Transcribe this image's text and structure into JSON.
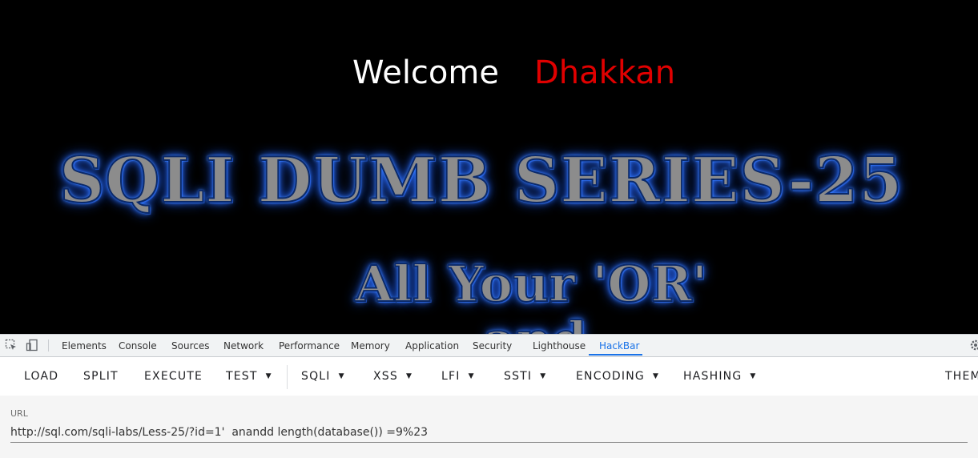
{
  "page": {
    "welcome_text": "Welcome",
    "user_name": "Dhakkan",
    "banner_title": "SQLI DUMB SERIES-25",
    "banner_subtitle": "All Your 'OR'",
    "banner_partial": "and"
  },
  "devtools": {
    "tabs": [
      "Elements",
      "Console",
      "Sources",
      "Network",
      "Performance",
      "Memory",
      "Application",
      "Security",
      "Lighthouse",
      "HackBar"
    ],
    "active_tab": "HackBar",
    "icons": [
      "inspect-icon",
      "device-toolbar-icon",
      "settings-icon"
    ]
  },
  "hackbar": {
    "buttons": [
      "LOAD",
      "SPLIT",
      "EXECUTE",
      "TEST",
      "SQLI",
      "XSS",
      "LFI",
      "SSTI",
      "ENCODING",
      "HASHING",
      "THEME"
    ],
    "url_label": "URL",
    "url_value": "http://sql.com/sqli-labs/Less-25/?id=1'  anandd length(database()) =9%23"
  },
  "colors": {
    "user_name": "#e00000",
    "active_tab": "#1a73e8",
    "banner_glow": "#2f6fff"
  }
}
